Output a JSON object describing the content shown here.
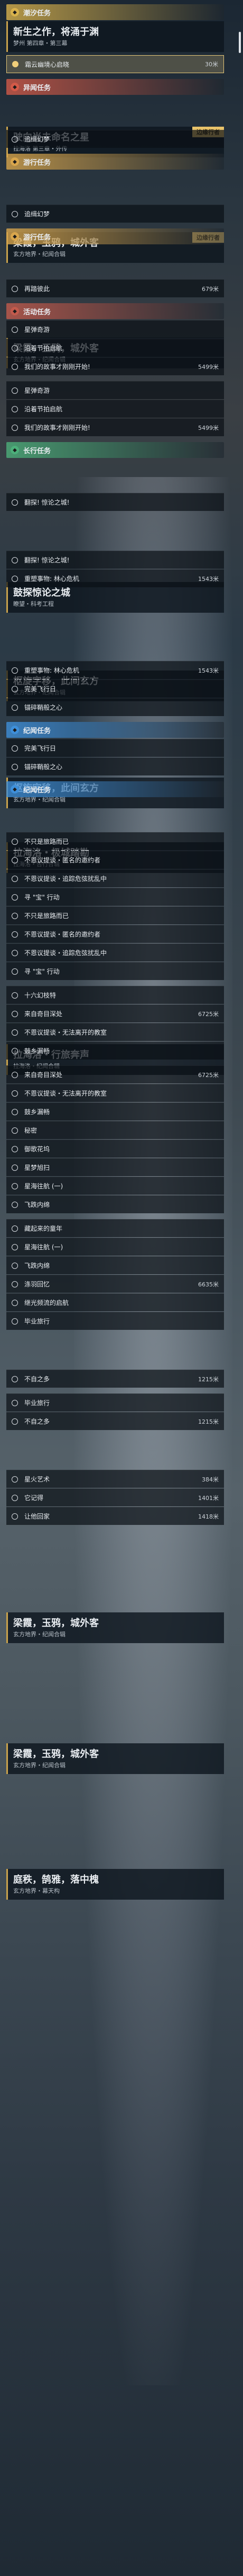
{
  "sections": [
    {
      "name": "潮汐任务",
      "color": "#d9b24c"
    },
    {
      "name": "异闻任务",
      "color": "#d35a48"
    },
    {
      "name": "游行任务",
      "color": "#d9a64c"
    },
    {
      "name": "活动任务",
      "color": "#c25a4c"
    },
    {
      "name": "纪闻任务",
      "color": "#3e8fd9"
    },
    {
      "name": "长行任务",
      "color": "#4caf7a"
    }
  ],
  "cards": [
    {
      "title": "新生之作，将涌于渊",
      "sub": "梦州 第四章・第三幕"
    },
    {
      "title": "驶向尚未命名之星",
      "sub": "拉海洛 第三章・外传",
      "badge": "边缘行者"
    },
    {
      "title": "梁霞，玉鸦，城外客",
      "sub": "玄方地界・纪闻合辑",
      "badge": "边缘行者"
    },
    {
      "title": "梁霞，玉鸦，城外客",
      "sub": "玄方地界・纪闻合辑"
    },
    {
      "title": "鼓探惊论之城",
      "sub": "瞭望・科考工程"
    },
    {
      "title": "枢旋字移，此间玄方",
      "sub": "玄方地界・纪闻合辑"
    },
    {
      "title": "枢旋字移，此间玄方",
      "sub": "玄方地界・纪闻合辑"
    },
    {
      "title": "拉海洛・极城踏勘",
      "sub": "拉海洛・告行合辑"
    },
    {
      "title": "拉海洛・行旅奔声",
      "sub": "拉海洛・纪闻合辑"
    },
    {
      "title": "梁霞，玉鸦，城外客",
      "sub": "玄方地界・纪闻合辑"
    },
    {
      "title": "梁霞，玉鸦，城外客",
      "sub": "玄方地界・纪闻合辑"
    },
    {
      "title": "庭秩，鹄雅，落中槐",
      "sub": "玄方地界・幕天构"
    }
  ],
  "rows": [
    {
      "text": "霜云幽境心启晓",
      "dist": "30米",
      "sel": true
    },
    {
      "text": "追缉幻梦"
    },
    {
      "text": "追缉幻梦"
    },
    {
      "text": "再踏彼此",
      "dist": "679米"
    },
    {
      "text": "星弹奇游"
    },
    {
      "text": "沿着节拍启航"
    },
    {
      "text": "我们的故事才刚刚开始!",
      "dist": "5499米"
    },
    {
      "text": "星弹奇游"
    },
    {
      "text": "沿着节拍启航"
    },
    {
      "text": "我们的故事才刚刚开始!",
      "dist": "5499米"
    },
    {
      "text": "翻探! 惊论之城!"
    },
    {
      "text": "翻探! 惊论之城!"
    },
    {
      "text": "重塑事物: 林心危机",
      "dist": "1543米"
    },
    {
      "text": "重塑事物: 林心危机",
      "dist": "1543米"
    },
    {
      "text": "完美飞行日"
    },
    {
      "text": "锚碎鞘般之心"
    },
    {
      "text": "完美飞行日"
    },
    {
      "text": "锚碎鞘般之心"
    },
    {
      "text": "不只是旅路而已"
    },
    {
      "text": "不恩议提谈・匿名的邀约者"
    },
    {
      "text": "不恩议提谈・追踪危弦扰乱中"
    },
    {
      "text": "寻 \"宝\" 行动"
    },
    {
      "text": "不只是旅路而已"
    },
    {
      "text": "不恩议提谈・匿名的邀约者"
    },
    {
      "text": "不恩议提谈・追踪危弦扰乱中"
    },
    {
      "text": "寻 \"宝\" 行动"
    },
    {
      "text": "十六幻枝特"
    },
    {
      "text": "来自奇目深处",
      "dist": "6725米"
    },
    {
      "text": "不恩议提谈・无法离开的教室"
    },
    {
      "text": "鼓乡漏畅"
    },
    {
      "text": "来自奇目深处",
      "dist": "6725米"
    },
    {
      "text": "不恩议提谈・无法离开的教室"
    },
    {
      "text": "鼓乡漏畅"
    },
    {
      "text": "秘密"
    },
    {
      "text": "御歌花坞"
    },
    {
      "text": "星梦旭扫"
    },
    {
      "text": "星海往航 (一)"
    },
    {
      "text": "飞跌内绵"
    },
    {
      "text": "藏起来的童年"
    },
    {
      "text": "星海往航 (一)"
    },
    {
      "text": "飞跌内绵"
    },
    {
      "text": "涤羽回忆",
      "dist": "6635米"
    },
    {
      "text": "继光频流的启航"
    },
    {
      "text": "毕业旅行"
    },
    {
      "text": "不自之多",
      "dist": "1215米"
    },
    {
      "text": "毕业旅行"
    },
    {
      "text": "不自之多",
      "dist": "1215米"
    },
    {
      "text": "星火艺术",
      "dist": "384米"
    },
    {
      "text": "它记得",
      "dist": "1401米"
    },
    {
      "text": "让他回家",
      "dist": "1418米"
    }
  ],
  "ui": {
    "collapse_icon": "chevron-up-icon",
    "check_icon": "check-icon"
  }
}
